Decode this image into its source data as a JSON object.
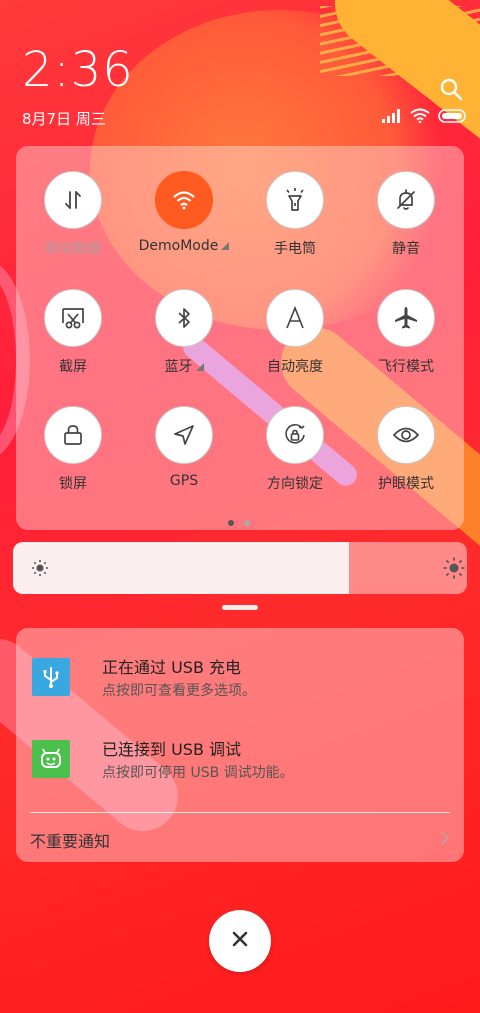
{
  "status": {
    "time": "2:36",
    "date": "8月7日 周三",
    "icons": [
      "signal-icon",
      "wifi-icon",
      "battery-icon"
    ]
  },
  "quick_settings": {
    "tiles": [
      {
        "label": "移动数据",
        "icon": "data-transfer-icon",
        "active": false,
        "dim": true
      },
      {
        "label": "DemoMode",
        "icon": "wifi-icon",
        "active": true,
        "has_caret": true
      },
      {
        "label": "手电筒",
        "icon": "flashlight-icon",
        "active": false
      },
      {
        "label": "静音",
        "icon": "bell-off-icon",
        "active": false
      },
      {
        "label": "截屏",
        "icon": "screenshot-icon",
        "active": false
      },
      {
        "label": "蓝牙",
        "icon": "bluetooth-icon",
        "active": false,
        "has_caret": true
      },
      {
        "label": "自动亮度",
        "icon": "auto-brightness-icon",
        "active": false
      },
      {
        "label": "飞行模式",
        "icon": "airplane-icon",
        "active": false
      },
      {
        "label": "锁屏",
        "icon": "lock-icon",
        "active": false
      },
      {
        "label": "GPS",
        "icon": "location-arrow-icon",
        "active": false
      },
      {
        "label": "方向锁定",
        "icon": "rotation-lock-icon",
        "active": false
      },
      {
        "label": "护眼模式",
        "icon": "eye-icon",
        "active": false
      }
    ],
    "page_count": 2,
    "current_page": 1
  },
  "brightness": {
    "level": 0.74
  },
  "notifications": [
    {
      "title": "正在通过 USB 充电",
      "body": "点按即可查看更多选项。",
      "icon": "usb-icon",
      "icon_color": "#3aa8e0"
    },
    {
      "title": "已连接到 USB 调试",
      "body": "点按即可停用 USB 调试功能。",
      "icon": "android-icon",
      "icon_color": "#4cc04c"
    }
  ],
  "unimportant_label": "不重要通知",
  "colors": {
    "accent": "#ff5a1f",
    "background": "#ff2b2b"
  }
}
